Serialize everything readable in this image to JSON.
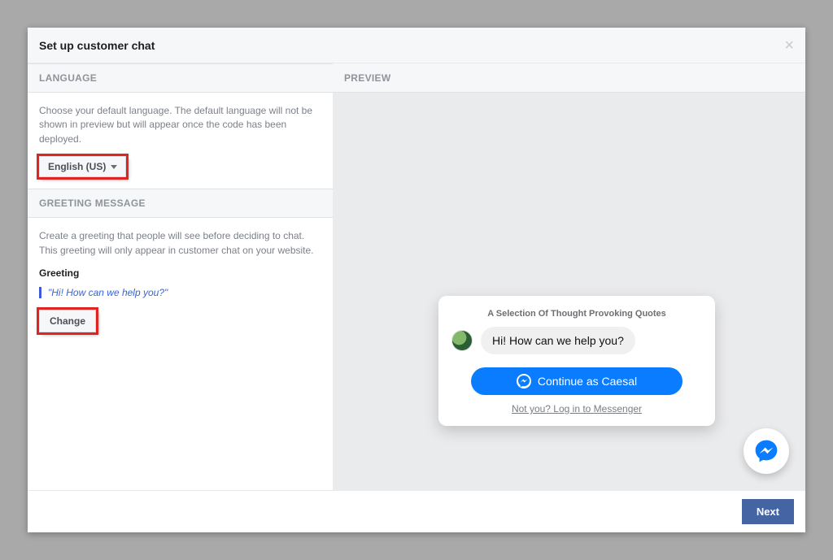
{
  "header": {
    "title": "Set up customer chat"
  },
  "left": {
    "language": {
      "heading": "LANGUAGE",
      "help": "Choose your default language. The default language will not be shown in preview but will appear once the code has been deployed.",
      "selected": "English (US)"
    },
    "greeting": {
      "heading": "GREETING MESSAGE",
      "help": "Create a greeting that people will see before deciding to chat. This greeting will only appear in customer chat on your website.",
      "label": "Greeting",
      "text": "\"Hi! How can we help you?\"",
      "change_label": "Change"
    }
  },
  "preview": {
    "heading": "PREVIEW",
    "card": {
      "title": "A Selection Of Thought Provoking Quotes",
      "bubble": "Hi! How can we help you?",
      "continue_label": "Continue as Caesal",
      "notyou": "Not you? Log in to Messenger"
    }
  },
  "footer": {
    "next_label": "Next"
  }
}
